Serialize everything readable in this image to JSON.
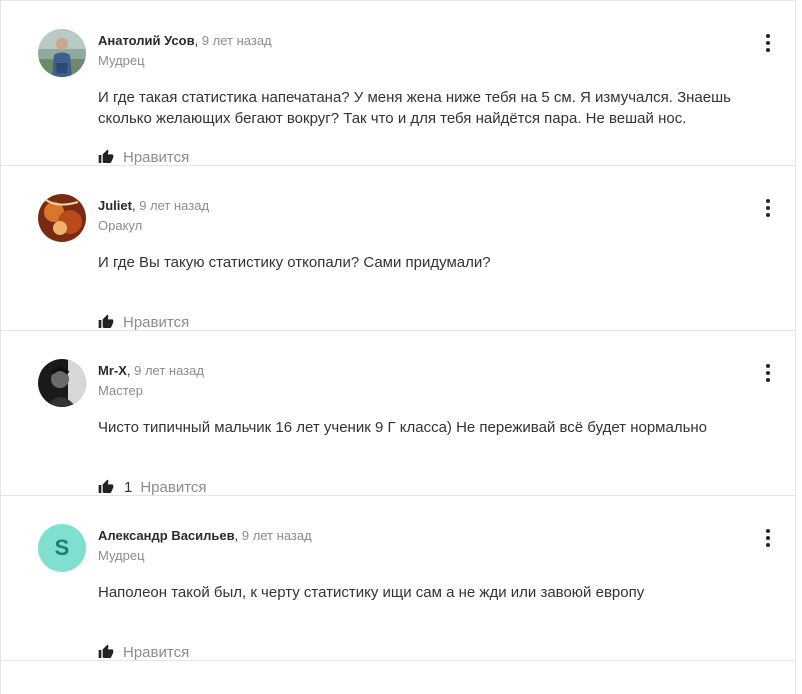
{
  "answers": [
    {
      "author": "Анатолий Усов",
      "time": "9 лет назад",
      "rank": "Мудрец",
      "text": "И где такая статистика напечатана? У меня жена ниже тебя на 5 см. Я измучался. Знаешь сколько желающих бегают вокруг? Так что и для тебя найдётся пара. Не вешай нос.",
      "likes": "",
      "like_label": "Нравится",
      "avatar": "photo-man-outdoors"
    },
    {
      "author": "Juliet",
      "time": "9 лет назад",
      "rank": "Оракул",
      "text": "И где Вы такую статистику откопали? Сами придумали?",
      "likes": "",
      "like_label": "Нравится",
      "avatar": "photo-artwork-warm"
    },
    {
      "author": "Mr-X",
      "time": "9 лет назад",
      "rank": "Мастер",
      "text": "Чисто типичный мальчик 16 лет ученик 9 Г класса) Не переживай всё будет нормально",
      "likes": "1",
      "like_label": "Нравится",
      "avatar": "photo-bw-portrait"
    },
    {
      "author": "Александр Васильев",
      "time": "9 лет назад",
      "rank": "Мудрец",
      "text": "Наполеон такой был, к черту статистику ищи сам а не жди или завоюй европу",
      "likes": "",
      "like_label": "Нравится",
      "avatar_letter": "S",
      "avatar_color": "#7fe0cf"
    }
  ],
  "icons": {
    "like": "thumbs-up-icon",
    "more": "more-vertical-icon"
  }
}
